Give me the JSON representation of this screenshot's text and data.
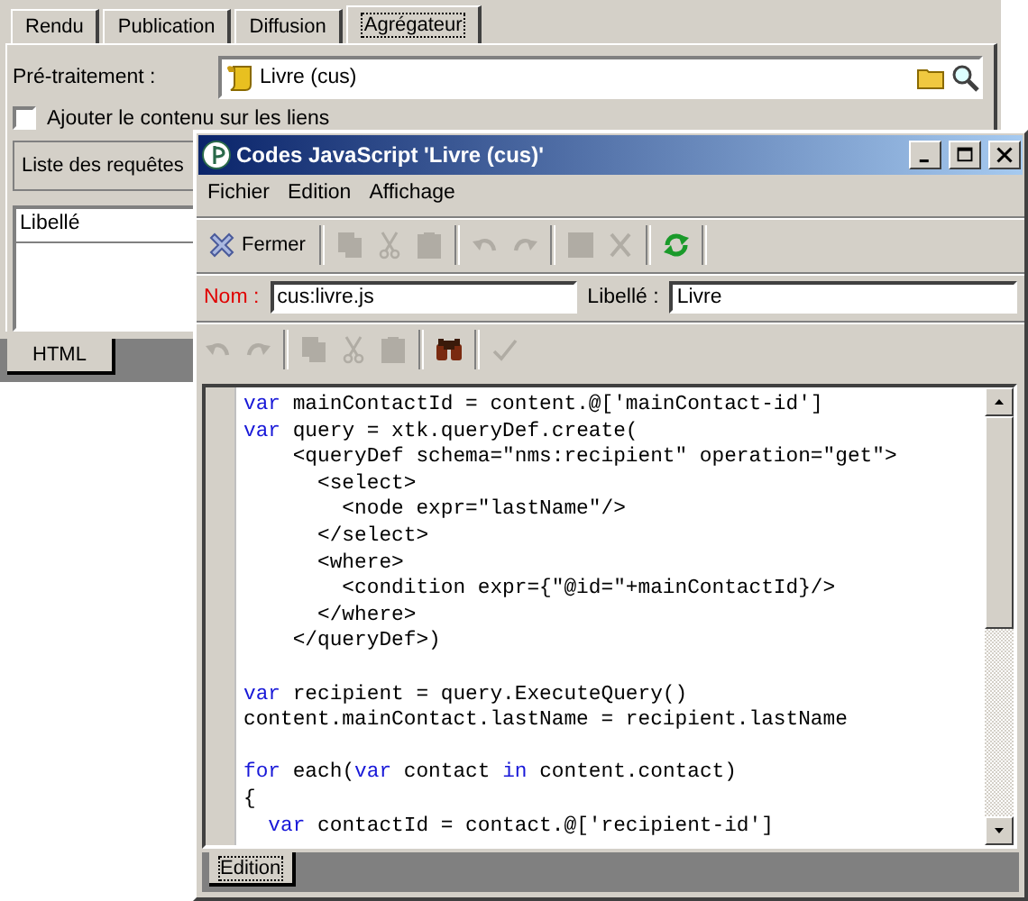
{
  "main_window": {
    "tabs": [
      {
        "label": "Rendu",
        "selected": false
      },
      {
        "label": "Publication",
        "selected": false
      },
      {
        "label": "Diffusion",
        "selected": false
      },
      {
        "label": "Agrégateur",
        "selected": true
      }
    ],
    "pretraitement": {
      "label": "Pré-traitement :",
      "value": "Livre (cus)"
    },
    "add_content": {
      "label": "Ajouter le contenu sur les liens",
      "checked": false
    },
    "query_list": {
      "label": "Liste des requêtes"
    },
    "table": {
      "columns": [
        "Libellé"
      ]
    },
    "bottom_tabs": [
      {
        "label": "HTML",
        "selected": true
      }
    ]
  },
  "dialog": {
    "title": "Codes JavaScript 'Livre (cus)'",
    "menu": [
      "Fichier",
      "Edition",
      "Affichage"
    ],
    "toolbar": [
      {
        "kind": "close",
        "label": "Fermer",
        "disabled": false
      },
      {
        "kind": "separator"
      },
      {
        "kind": "copy",
        "disabled": true
      },
      {
        "kind": "cut",
        "disabled": true
      },
      {
        "kind": "paste",
        "disabled": true
      },
      {
        "kind": "separator"
      },
      {
        "kind": "undo",
        "disabled": true
      },
      {
        "kind": "redo",
        "disabled": true
      },
      {
        "kind": "separator"
      },
      {
        "kind": "save",
        "disabled": true
      },
      {
        "kind": "delete",
        "disabled": true
      },
      {
        "kind": "separator"
      },
      {
        "kind": "refresh",
        "disabled": false
      },
      {
        "kind": "separator"
      }
    ],
    "fields": [
      {
        "label": "Nom :",
        "value": "cus:livre.js",
        "required": true
      },
      {
        "label": "Libellé :",
        "value": "Livre",
        "required": false
      }
    ],
    "editor_toolbar": [
      {
        "kind": "undo",
        "disabled": true
      },
      {
        "kind": "redo",
        "disabled": true
      },
      {
        "kind": "separator"
      },
      {
        "kind": "copy",
        "disabled": true
      },
      {
        "kind": "cut",
        "disabled": true
      },
      {
        "kind": "paste",
        "disabled": true
      },
      {
        "kind": "separator"
      },
      {
        "kind": "find",
        "disabled": false
      },
      {
        "kind": "separator"
      },
      {
        "kind": "check",
        "disabled": true
      }
    ],
    "code": [
      {
        "kind": "code",
        "tokens": [
          {
            "kind": "keyword",
            "text": "var"
          },
          {
            "kind": "plain",
            "text": " mainContactId = content.@['mainContact-id']"
          }
        ]
      },
      {
        "kind": "code",
        "tokens": [
          {
            "kind": "keyword",
            "text": "var"
          },
          {
            "kind": "plain",
            "text": " query = xtk.queryDef.create("
          }
        ]
      },
      {
        "kind": "code",
        "tokens": [
          {
            "kind": "plain",
            "text": "    <queryDef schema=\"nms:recipient\" operation=\"get\">"
          }
        ]
      },
      {
        "kind": "code",
        "tokens": [
          {
            "kind": "plain",
            "text": "      <select>"
          }
        ]
      },
      {
        "kind": "code",
        "tokens": [
          {
            "kind": "plain",
            "text": "        <node expr=\"lastName\"/>"
          }
        ]
      },
      {
        "kind": "code",
        "tokens": [
          {
            "kind": "plain",
            "text": "      </select>"
          }
        ]
      },
      {
        "kind": "code",
        "tokens": [
          {
            "kind": "plain",
            "text": "      <where>"
          }
        ]
      },
      {
        "kind": "code",
        "tokens": [
          {
            "kind": "plain",
            "text": "        <condition expr={\"@id=\"+mainContactId}/>"
          }
        ]
      },
      {
        "kind": "code",
        "tokens": [
          {
            "kind": "plain",
            "text": "      </where>"
          }
        ]
      },
      {
        "kind": "code",
        "tokens": [
          {
            "kind": "plain",
            "text": "    </queryDef>)"
          }
        ]
      },
      {
        "kind": "blank"
      },
      {
        "kind": "code",
        "tokens": [
          {
            "kind": "keyword",
            "text": "var"
          },
          {
            "kind": "plain",
            "text": " recipient = query.ExecuteQuery()"
          }
        ]
      },
      {
        "kind": "code",
        "tokens": [
          {
            "kind": "plain",
            "text": "content.mainContact.lastName = recipient.lastName"
          }
        ]
      },
      {
        "kind": "blank"
      },
      {
        "kind": "code",
        "tokens": [
          {
            "kind": "keyword",
            "text": "for"
          },
          {
            "kind": "plain",
            "text": " each("
          },
          {
            "kind": "keyword",
            "text": "var"
          },
          {
            "kind": "plain",
            "text": " contact "
          },
          {
            "kind": "keyword",
            "text": "in"
          },
          {
            "kind": "plain",
            "text": " content.contact)"
          }
        ]
      },
      {
        "kind": "code",
        "tokens": [
          {
            "kind": "plain",
            "text": "{"
          }
        ]
      },
      {
        "kind": "code",
        "tokens": [
          {
            "kind": "keyword",
            "text": "  var"
          },
          {
            "kind": "plain",
            "text": " contactId = contact.@['recipient-id']"
          }
        ]
      }
    ],
    "bottom_tabs": [
      {
        "label": "Edition",
        "selected": true
      }
    ]
  }
}
